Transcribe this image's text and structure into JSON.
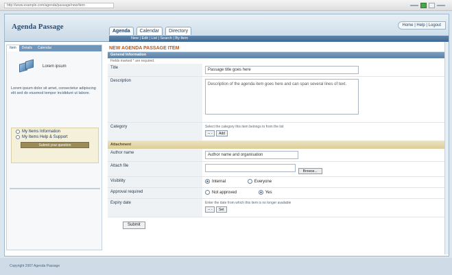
{
  "browser": {
    "url": "http://www.example.com/agenda/passage/new/item"
  },
  "app": {
    "title": "Agenda Passage",
    "tabs": [
      "Agenda",
      "Calendar",
      "Directory"
    ],
    "top_links": "Home | Help | Logout",
    "subnav": "New | Edit | List | Search | By Item"
  },
  "sidebar": {
    "tabs": [
      "Item",
      "Details",
      "Calendar"
    ],
    "title": "Lorem ipsum",
    "text": "Lorem ipsum dolor sit amet, consectetur adipiscing elit sed do eiusmod tempor incididunt ut labore.",
    "options": [
      "My Items Information",
      "My Items Help & Support"
    ],
    "button": "Submit your question"
  },
  "form": {
    "section_title": "NEW AGENDA PASSAGE ITEM",
    "band_general": "General Information",
    "note": "Fields marked * are required.",
    "title_label": "Title",
    "title_value": "Passage title goes here",
    "description_label": "Description",
    "description_value": "Description of the agenda item goes here and can span several lines of text.",
    "category_label": "Category",
    "category_hint": "Select the category this item belongs to from the list",
    "category_select": "-- -",
    "category_add": "Add",
    "band_attachment": "Attachment",
    "name_label": "Author name",
    "name_value": "Author name and organisation",
    "file_label": "Attach file",
    "browse_label": "Browse...",
    "visibility_label": "Visibility",
    "visibility_options": [
      "Internal",
      "Everyone"
    ],
    "approval_label": "Approval required",
    "approval_options": [
      "Not approved",
      "Yes"
    ],
    "expiry_label": "Expiry date",
    "expiry_hint": "Enter the date from which this item is no longer available",
    "expiry_select": "-- -",
    "expiry_btn": "Set",
    "submit": "Submit"
  },
  "footer": {
    "text": "Copyright 2007 Agenda Passage"
  }
}
